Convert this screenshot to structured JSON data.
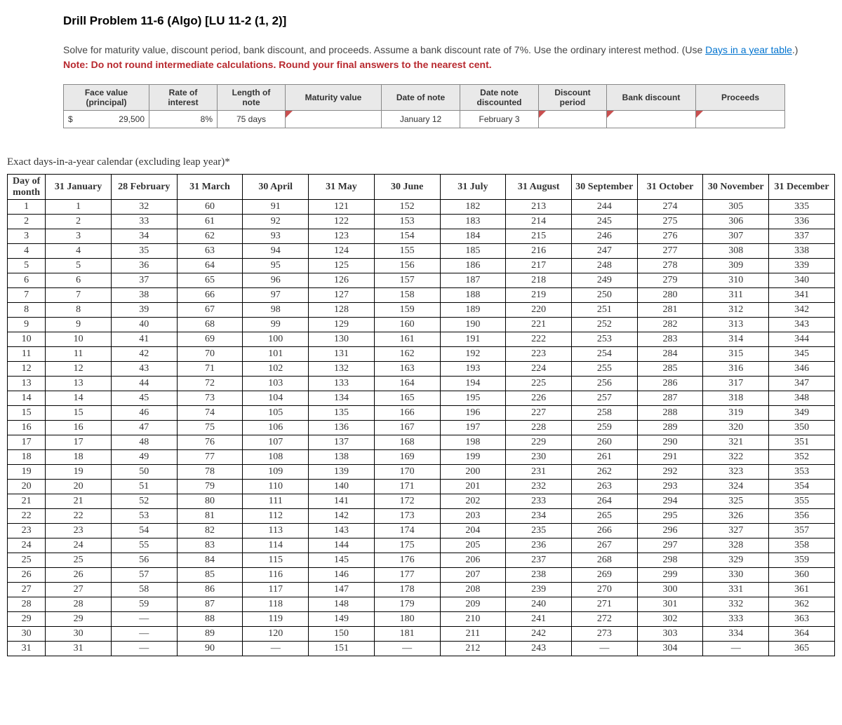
{
  "title": "Drill Problem 11-6 (Algo) [LU 11-2 (1, 2)]",
  "instr_line1_a": "Solve for maturity value, discount period, bank discount, and proceeds. Assume a bank discount rate of 7%. Use the ordinary interest method. (Use ",
  "instr_link": "Days in a year table",
  "instr_line1_b": ".)",
  "note": "Note: Do not round intermediate calculations. Round your final answers to the nearest cent.",
  "headers": {
    "face": "Face value (principal)",
    "rate": "Rate of interest",
    "length": "Length of note",
    "maturity": "Maturity value",
    "date_note": "Date of note",
    "date_disc": "Date note discounted",
    "disc_period": "Discount period",
    "bank_disc": "Bank discount",
    "proceeds": "Proceeds"
  },
  "row": {
    "currency": "$",
    "face": "29,500",
    "rate": "8%",
    "length": "75 days",
    "maturity": "",
    "date_note": "January 12",
    "date_disc": "February 3",
    "disc_period": "",
    "bank_disc": "",
    "proceeds": ""
  },
  "calendar_caption": "Exact days-in-a-year calendar (excluding leap year)*",
  "chart_data": {
    "type": "table",
    "headers": [
      "Day of month",
      "31 January",
      "28 February",
      "31 March",
      "30 April",
      "31 May",
      "30 June",
      "31 July",
      "31 August",
      "30 September",
      "31 October",
      "30 November",
      "31 December"
    ],
    "month_lengths": [
      31,
      28,
      31,
      30,
      31,
      30,
      31,
      31,
      30,
      31,
      30,
      31
    ],
    "month_start_offsets": [
      0,
      31,
      59,
      90,
      120,
      151,
      181,
      212,
      243,
      273,
      304,
      334
    ]
  }
}
